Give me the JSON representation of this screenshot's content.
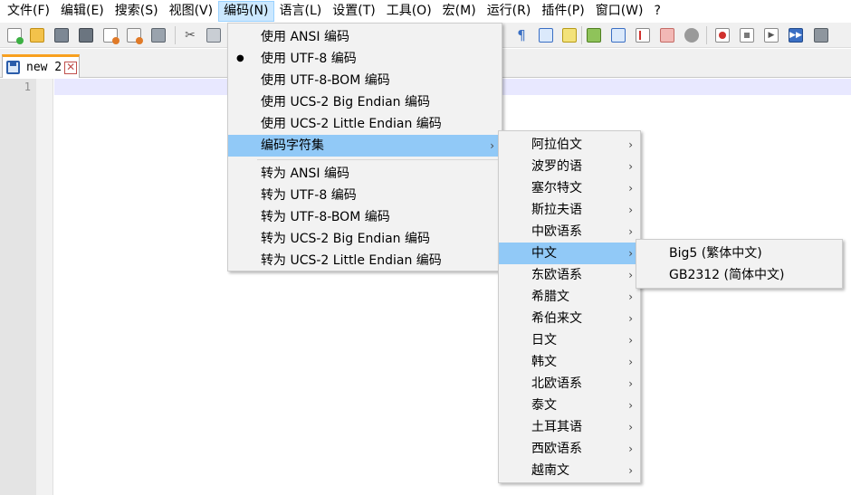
{
  "menubar": [
    "文件(F)",
    "编辑(E)",
    "搜索(S)",
    "视图(V)",
    "编码(N)",
    "语言(L)",
    "设置(T)",
    "工具(O)",
    "宏(M)",
    "运行(R)",
    "插件(P)",
    "窗口(W)",
    "?"
  ],
  "tab": {
    "label": "new 2",
    "close": "✕"
  },
  "editor": {
    "line_number": "1"
  },
  "encoding_menu": {
    "items_top": [
      {
        "label": "使用 ANSI 编码",
        "checked": false
      },
      {
        "label": "使用 UTF-8 编码",
        "checked": true
      },
      {
        "label": "使用 UTF-8-BOM 编码",
        "checked": false
      },
      {
        "label": "使用 UCS-2 Big Endian 编码",
        "checked": false
      },
      {
        "label": "使用 UCS-2 Little Endian 编码",
        "checked": false
      }
    ],
    "charset_item": "编码字符集",
    "items_bottom": [
      "转为 ANSI 编码",
      "转为 UTF-8 编码",
      "转为 UTF-8-BOM 编码",
      "转为 UCS-2 Big Endian 编码",
      "转为 UCS-2 Little Endian 编码"
    ],
    "check_glyph": "●",
    "arrow_glyph": "›"
  },
  "charset_menu": [
    "阿拉伯文",
    "波罗的语",
    "塞尔特文",
    "斯拉夫语",
    "中欧语系",
    "中文",
    "东欧语系",
    "希腊文",
    "希伯来文",
    "日文",
    "韩文",
    "北欧语系",
    "泰文",
    "土耳其语",
    "西欧语系",
    "越南文"
  ],
  "chinese_menu": [
    "Big5 (繁体中文)",
    "GB2312 (简体中文)"
  ],
  "colors": {
    "menu_highlight": "#91c9f7",
    "menubar_open": "#cce8ff",
    "tab_accent": "#f8a01e",
    "current_line": "#e8e8ff"
  },
  "toolbar_icons": [
    "new-file",
    "open-file",
    "save",
    "save-all",
    "close",
    "close-all",
    "print",
    "cut",
    "copy",
    "show-all-characters",
    "indent-guide",
    "document-map",
    "function-list",
    "folder-as-workspace",
    "monitoring",
    "start-recording",
    "stop-recording",
    "playback",
    "run-multiple",
    "save-macro"
  ]
}
